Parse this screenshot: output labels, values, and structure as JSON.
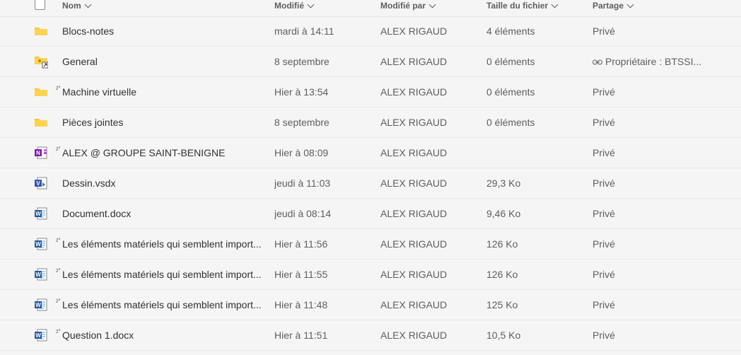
{
  "header": {
    "name": "Nom",
    "modified": "Modifié",
    "modified_by": "Modifié par",
    "size": "Taille du fichier",
    "sharing": "Partage"
  },
  "rows": [
    {
      "name": "Blocs-notes",
      "modified": "mardi à 14:11",
      "by": "ALEX RIGAUD",
      "size": "4 éléments",
      "sharing": "Privé",
      "icon": "folder-icon",
      "new": false
    },
    {
      "name": "General",
      "modified": "8 septembre",
      "by": "ALEX RIGAUD",
      "size": "0 éléments",
      "sharing": "Propriétaire : BTSSI...",
      "icon": "shared-folder-icon",
      "new": false
    },
    {
      "name": "Machine virtuelle",
      "modified": "Hier à 13:54",
      "by": "ALEX RIGAUD",
      "size": "0 éléments",
      "sharing": "Privé",
      "icon": "folder-icon",
      "new": true
    },
    {
      "name": "Pièces jointes",
      "modified": "8 septembre",
      "by": "ALEX RIGAUD",
      "size": "0 éléments",
      "sharing": "Privé",
      "icon": "folder-icon",
      "new": false
    },
    {
      "name": "ALEX @ GROUPE SAINT-BENIGNE",
      "modified": "Hier à 08:09",
      "by": "ALEX RIGAUD",
      "size": "",
      "sharing": "Privé",
      "icon": "onenote-icon",
      "new": true
    },
    {
      "name": "Dessin.vsdx",
      "modified": "jeudi à 11:03",
      "by": "ALEX RIGAUD",
      "size": "29,3 Ko",
      "sharing": "Privé",
      "icon": "visio-icon",
      "new": false
    },
    {
      "name": "Document.docx",
      "modified": "jeudi à 08:14",
      "by": "ALEX RIGAUD",
      "size": "9,46 Ko",
      "sharing": "Privé",
      "icon": "word-icon",
      "new": false
    },
    {
      "name": "Les éléments matériels qui semblent import...",
      "modified": "Hier à 11:56",
      "by": "ALEX RIGAUD",
      "size": "126 Ko",
      "sharing": "Privé",
      "icon": "word-icon",
      "new": true
    },
    {
      "name": "Les éléments matériels qui semblent import...",
      "modified": "Hier à 11:55",
      "by": "ALEX RIGAUD",
      "size": "126 Ko",
      "sharing": "Privé",
      "icon": "word-icon",
      "new": true
    },
    {
      "name": "Les éléments matériels qui semblent import...",
      "modified": "Hier à 11:48",
      "by": "ALEX RIGAUD",
      "size": "125 Ko",
      "sharing": "Privé",
      "icon": "word-icon",
      "new": true
    },
    {
      "name": "Question 1.docx",
      "modified": "Hier à 11:51",
      "by": "ALEX RIGAUD",
      "size": "10,5 Ko",
      "sharing": "Privé",
      "icon": "word-icon",
      "new": true
    }
  ],
  "colors": {
    "folder": "#f8c43a",
    "word": "#2b579a",
    "onenote": "#7719aa",
    "visio": "#3955a3"
  }
}
